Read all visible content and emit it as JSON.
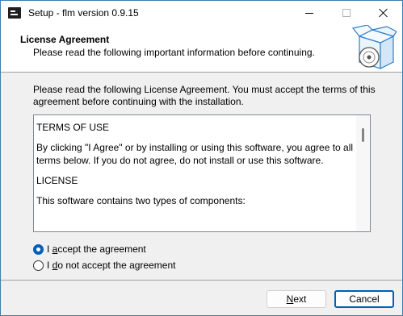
{
  "window": {
    "title": "Setup - flm version 0.9.15"
  },
  "header": {
    "title": "License Agreement",
    "subtitle": "Please read the following important information before continuing."
  },
  "main": {
    "intro": "Please read the following License Agreement. You must accept the terms of this agreement before continuing with the installation.",
    "license_paragraphs": [
      "TERMS OF USE",
      "By clicking \"I Agree\" or by installing or using this software, you agree to all terms below. If you do not agree, do not install or use this software.",
      "LICENSE",
      "This software contains two types of components:"
    ],
    "options": {
      "accept": {
        "pre": "I ",
        "key": "a",
        "post": "ccept the agreement",
        "checked": true
      },
      "decline": {
        "pre": "I ",
        "key": "d",
        "post": "o not accept the agreement",
        "checked": false
      }
    }
  },
  "footer": {
    "next": {
      "key": "N",
      "rest": "ext"
    },
    "cancel": "Cancel"
  },
  "icons": {
    "app": "installer-icon",
    "header": "package-box-disc-icon",
    "minimize": "minimize-icon",
    "maximize": "maximize-icon",
    "close": "close-icon"
  },
  "colors": {
    "accent": "#005fb8",
    "border": "#a0a0a0",
    "chrome": "#f0f0f0"
  }
}
